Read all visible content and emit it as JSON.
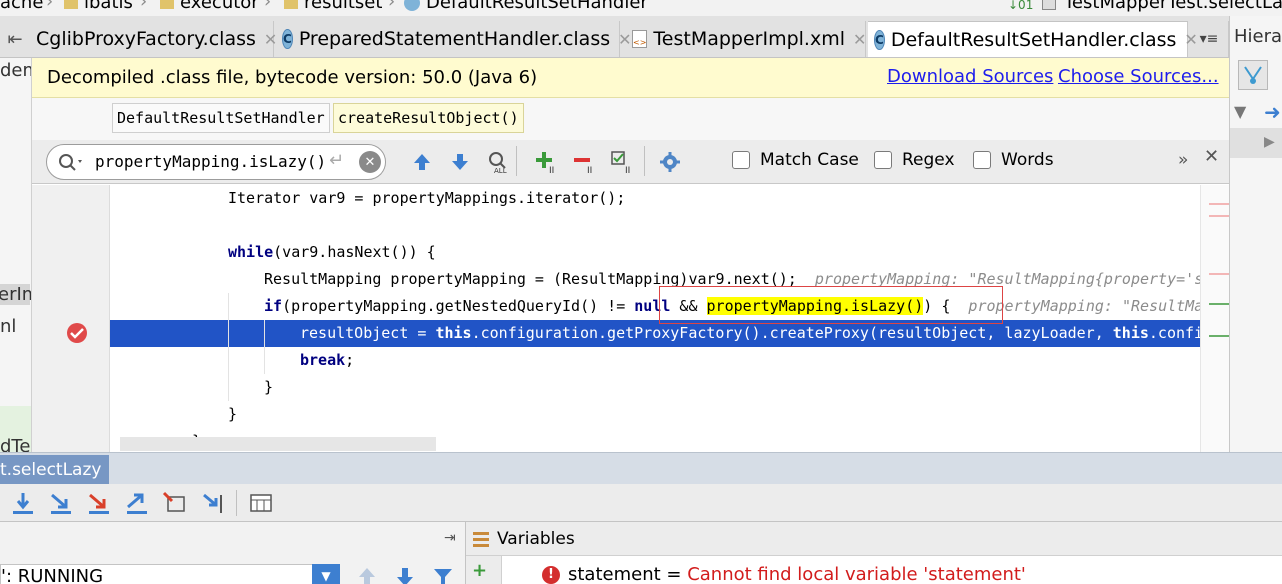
{
  "breadcrumb": [
    "ache",
    "ibatis",
    "executor",
    "resultset",
    "DefaultResultSetHandler"
  ],
  "run_config": "TestMapperTest.selectLa",
  "tabs": [
    {
      "label": "CglibProxyFactory.class",
      "icon": "class-icon"
    },
    {
      "label": "PreparedStatementHandler.class",
      "icon": "class-icon"
    },
    {
      "label": "TestMapperImpl.xml",
      "icon": "xml-file-icon"
    },
    {
      "label": "DefaultResultSetHandler.class",
      "icon": "class-icon",
      "active": true
    }
  ],
  "hierarchy_title": "Hierarc",
  "left_pane_fragments": [
    "dem",
    "erIm",
    "nl",
    "dTe"
  ],
  "banner": {
    "message": "Decompiled .class file, bytecode version: 50.0 (Java 6)",
    "download_link": "Download Sources",
    "choose_link": "Choose Sources..."
  },
  "method_crumbs": [
    "DefaultResultSetHandler",
    "createResultObject()"
  ],
  "search": {
    "query": "propertyMapping.isLazy()",
    "options": [
      "Match Case",
      "Regex",
      "Words"
    ],
    "more": "»"
  },
  "code": {
    "line1": "Iterator var9 = propertyMappings.iterator();",
    "line3_kw": "while",
    "line3_rest": "(var9.hasNext()) {",
    "line4_code": "ResultMapping propertyMapping = (ResultMapping)var9.next();",
    "line4_hint": "propertyMapping: \"ResultMapping{property='scor",
    "line5_kw": "if",
    "line5_a": "(propertyMapping.getNestedQueryId() != ",
    "line5_null": "null",
    "line5_b": " && ",
    "line5_match": "propertyMapping.isLazy()",
    "line5_c": ") {",
    "line5_hint": "propertyMapping: \"ResultMappi",
    "line6_a": "resultObject = ",
    "line6_this": "this",
    "line6_b": ".configuration.getProxyFactory().createProxy(resultObject, lazyLoader, ",
    "line6_this2": "this",
    "line6_c": ".configu",
    "line7": "break",
    "line7_semi": ";",
    "brace": "}"
  },
  "debug": {
    "session_tab": "t.selectLazy",
    "thread_status": "': RUNNING",
    "variables_title": "Variables",
    "variable_name": "statement",
    "variable_eq": " = ",
    "variable_error": "Cannot find local variable 'statement'"
  },
  "colors": {
    "execution_line": "#2154c6",
    "search_match": "#ffff00",
    "banner_bg": "#fffbcf",
    "link": "#1d1ded",
    "error_text": "#d21c1c"
  }
}
